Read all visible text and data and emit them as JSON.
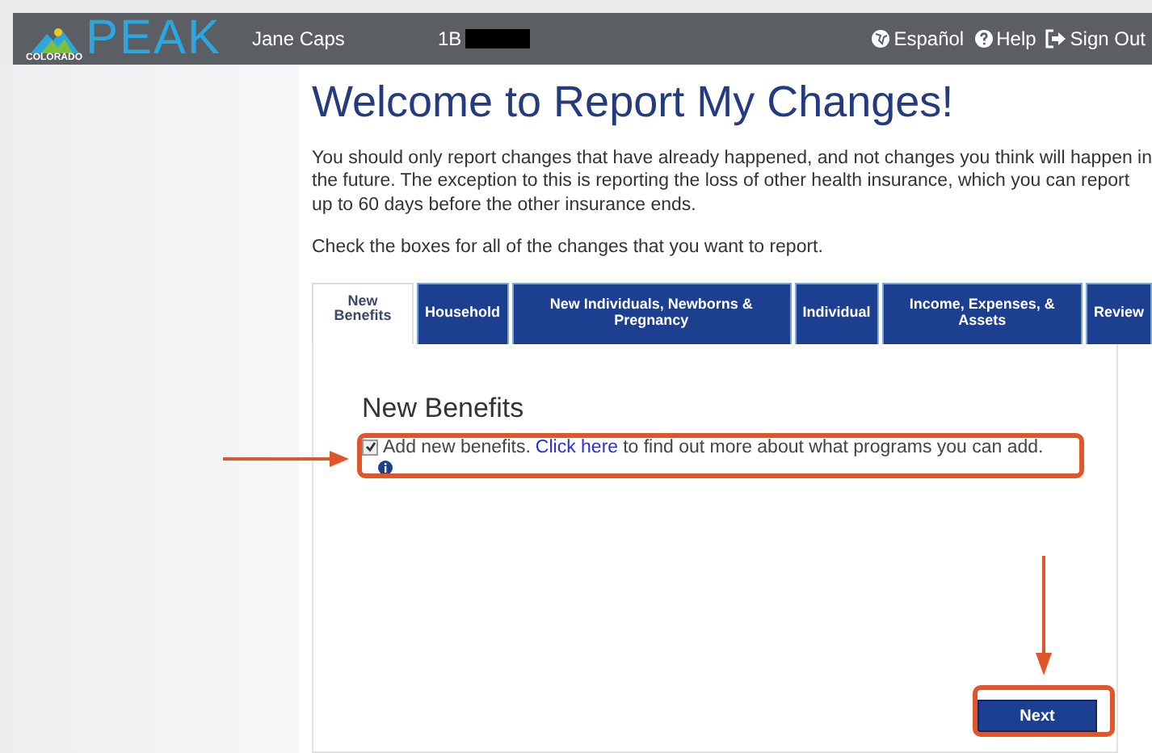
{
  "header": {
    "logo_text": "PEAK",
    "logo_subtext": "COLORADO",
    "user_name": "Jane Caps",
    "case_id": "1B",
    "links": [
      {
        "kind": "language",
        "label": "Español"
      },
      {
        "kind": "help",
        "label": "Help"
      },
      {
        "kind": "signout",
        "label": "Sign Out"
      }
    ]
  },
  "title": "Welcome to Report My Changes!",
  "intro": "You should only report changes that have already happened, and not changes you think will happen in the future. The exception to this is reporting the loss of other health insurance, which you can report up to 60 days before the other insurance ends.",
  "instruction": "Check the boxes for all of the changes that you want to report.",
  "tabs": [
    {
      "label": "New Benefits",
      "selected": true
    },
    {
      "label": "Household",
      "selected": false
    },
    {
      "label": "New Individuals, Newborns & Pregnancy",
      "selected": false
    },
    {
      "label": "Individual",
      "selected": false
    },
    {
      "label": "Income, Expenses, & Assets",
      "selected": false
    },
    {
      "label": "Review",
      "selected": false
    }
  ],
  "panel": {
    "heading": "New Benefits",
    "option": {
      "checked": true,
      "label": "Add new benefits.",
      "link": "Click here",
      "rest": "to find out more about what programs you can add."
    }
  },
  "next_button": "Next"
}
